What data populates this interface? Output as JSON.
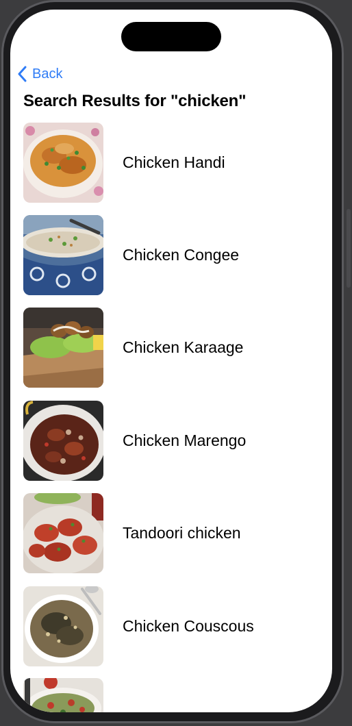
{
  "nav": {
    "back_label": "Back"
  },
  "page": {
    "title": "Search Results for \"chicken\""
  },
  "results": [
    {
      "name": "Chicken Handi",
      "thumb": "chicken-handi-photo"
    },
    {
      "name": "Chicken Congee",
      "thumb": "chicken-congee-photo"
    },
    {
      "name": "Chicken Karaage",
      "thumb": "chicken-karaage-photo"
    },
    {
      "name": "Chicken Marengo",
      "thumb": "chicken-marengo-photo"
    },
    {
      "name": "Tandoori chicken",
      "thumb": "tandoori-chicken-photo"
    },
    {
      "name": "Chicken Couscous",
      "thumb": "chicken-couscous-photo"
    },
    {
      "name": "",
      "thumb": "partial-dish-photo"
    }
  ],
  "colors": {
    "accent": "#2f7cf6",
    "background": "#ffffff",
    "frame": "#1b1b1d"
  }
}
